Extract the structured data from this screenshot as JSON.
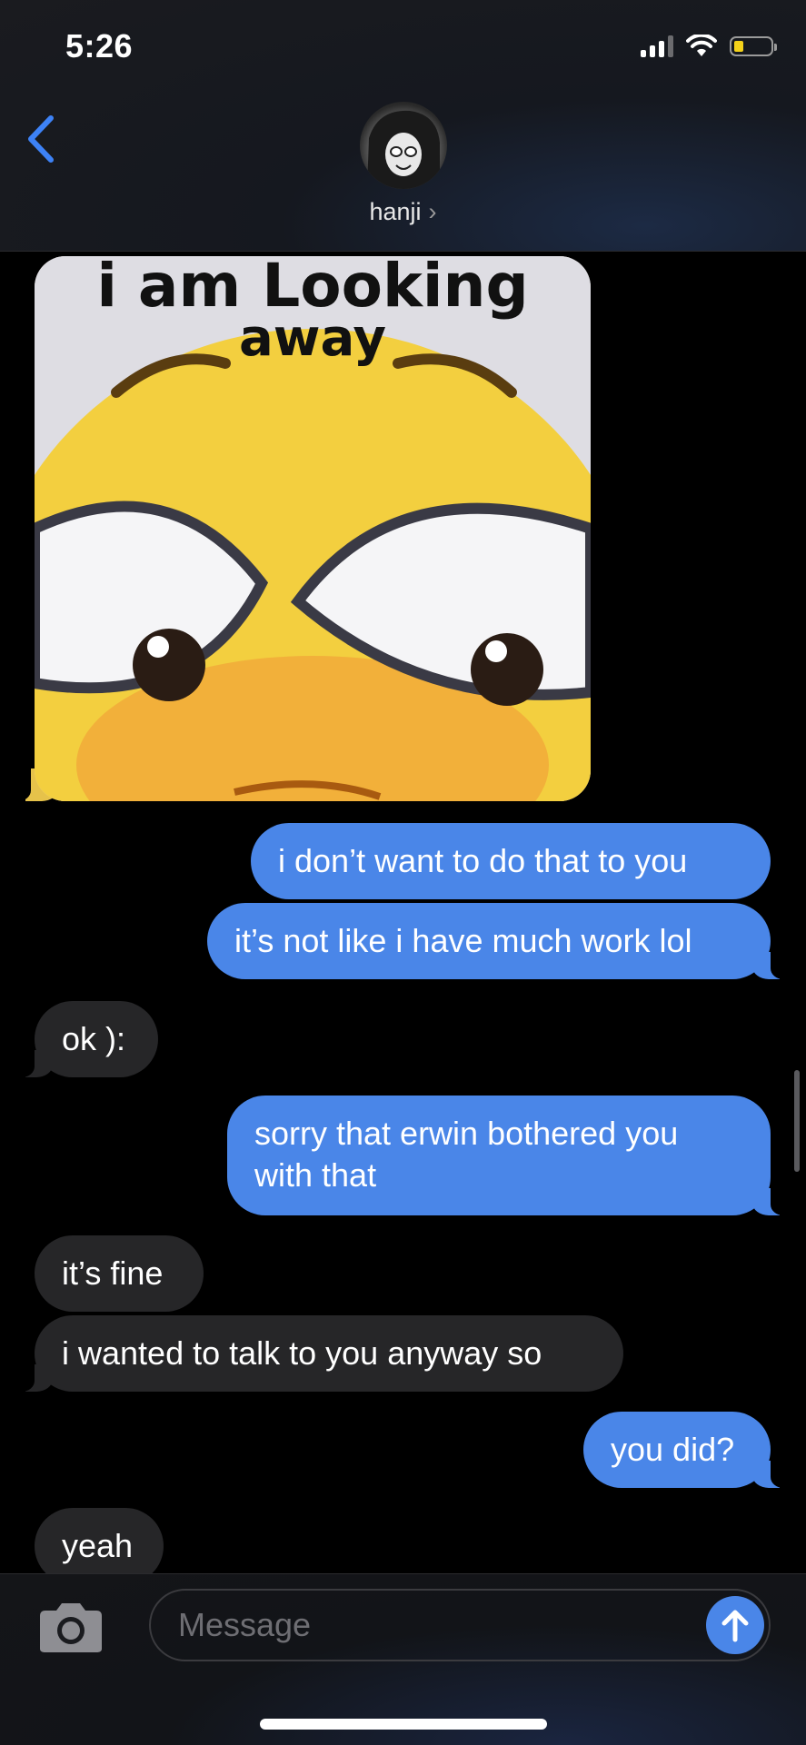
{
  "status_bar": {
    "time": "5:26"
  },
  "header": {
    "contact_name": "hanji",
    "chevron": "›"
  },
  "image_message": {
    "line1": "i am Looking",
    "line2": "away"
  },
  "messages": [
    {
      "side": "out",
      "text": "i don’t want to do that to you"
    },
    {
      "side": "out",
      "text": "it’s not like i have much work lol"
    },
    {
      "side": "in",
      "text": "ok ):"
    },
    {
      "side": "out",
      "text": "sorry that erwin bothered you with that"
    },
    {
      "side": "in",
      "text": "it’s fine"
    },
    {
      "side": "in",
      "text": "i wanted to talk to you anyway so"
    },
    {
      "side": "out",
      "text": "you did?"
    },
    {
      "side": "in",
      "text": "yeah"
    }
  ],
  "composer": {
    "placeholder": "Message"
  },
  "colors": {
    "outgoing": "#4a86e8",
    "incoming": "#262628",
    "accent": "#3d82f6"
  },
  "icons": {
    "back": "chevron-left-icon",
    "camera": "camera-icon",
    "send": "arrow-up-icon",
    "wifi": "wifi-icon",
    "signal": "signal-icon",
    "battery": "battery-icon"
  }
}
